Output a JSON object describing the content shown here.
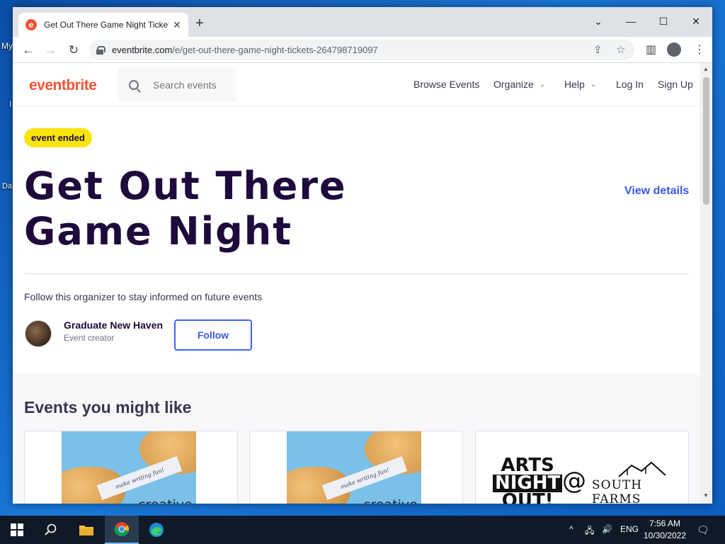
{
  "desktop": {
    "fragments": [
      "My",
      "I",
      "Da"
    ]
  },
  "browser": {
    "tab_title": "Get Out There Game Night Tickets",
    "tab_favicon": "e",
    "url_host": "eventbrite.com",
    "url_path": "/e/get-out-there-game-night-tickets-264798719097"
  },
  "site": {
    "logo": "eventbrite",
    "search_placeholder": "Search events",
    "nav": {
      "browse": "Browse Events",
      "organize": "Organize",
      "help": "Help",
      "login": "Log In",
      "signup": "Sign Up"
    }
  },
  "event": {
    "status_badge": "event ended",
    "title": "Get Out There Game Night",
    "view_details": "View details",
    "follow_prompt": "Follow this organizer to stay informed on future events",
    "organizer_name": "Graduate New Haven",
    "organizer_role": "Event creator",
    "follow_button": "Follow"
  },
  "suggestions": {
    "heading": "Events you might like",
    "cards": [
      {
        "paper_text": "make writing fun!",
        "brand_text": "creative"
      },
      {
        "paper_text": "make writing fun!",
        "brand_text": "creative"
      },
      {
        "line1": "ARTS",
        "line2": "NIGHT",
        "line3": "OUT!",
        "at": "@",
        "venue": "SOUTH FARMS"
      }
    ]
  },
  "taskbar": {
    "language": "ENG",
    "time": "7:56 AM",
    "date": "10/30/2022"
  },
  "colors": {
    "brand": "#f05537",
    "title": "#1e0a3c",
    "link": "#3659e3",
    "badge": "#f9e50b"
  }
}
